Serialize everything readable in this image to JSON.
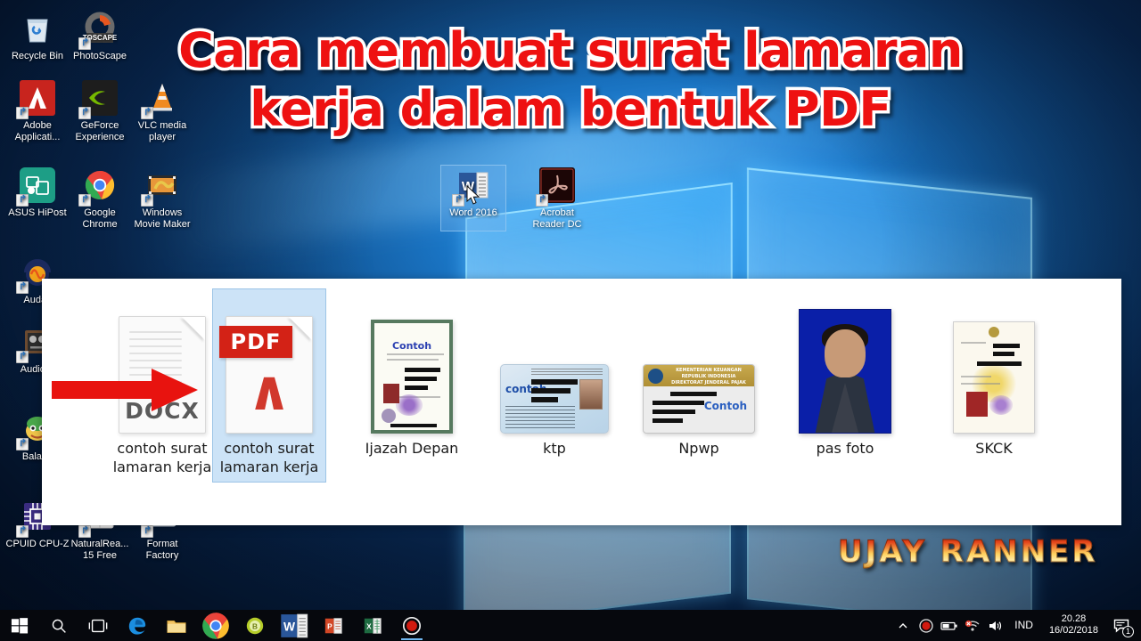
{
  "banner": {
    "line1": "Cara membuat surat lamaran",
    "line2": "kerja dalam bentuk PDF",
    "color": "#ee1111",
    "outline_color": "#ffffff"
  },
  "watermark": {
    "text": "UJAY RANNER"
  },
  "desktop": {
    "icons": [
      {
        "label": "Recycle Bin",
        "icon": "recycle-bin-icon",
        "shortcut": false,
        "col": 0,
        "row": 0
      },
      {
        "label": "PhotoScape",
        "icon": "photoscape-icon",
        "shortcut": true,
        "col": 1,
        "row": 0
      },
      {
        "label": "Adobe Applicati...",
        "icon": "adobe-icon",
        "shortcut": true,
        "col": 0,
        "row": 1
      },
      {
        "label": "GeForce Experience",
        "icon": "geforce-icon",
        "shortcut": true,
        "col": 1,
        "row": 1
      },
      {
        "label": "VLC media player",
        "icon": "vlc-cone-icon",
        "shortcut": true,
        "col": 2,
        "row": 1
      },
      {
        "label": "ASUS HiPost",
        "icon": "asus-hipost-icon",
        "shortcut": true,
        "col": 0,
        "row": 2
      },
      {
        "label": "Google Chrome",
        "icon": "chrome-icon",
        "shortcut": true,
        "col": 1,
        "row": 2
      },
      {
        "label": "Windows Movie Maker",
        "icon": "movie-maker-icon",
        "shortcut": true,
        "col": 2,
        "row": 2
      },
      {
        "label": "Audac",
        "icon": "audacity-icon",
        "shortcut": true,
        "col": 0,
        "row": 3
      },
      {
        "label": "AudioW",
        "icon": "audio-device-icon",
        "shortcut": true,
        "col": 0,
        "row": 4
      },
      {
        "label": "Balabo",
        "icon": "balabolka-icon",
        "shortcut": true,
        "col": 0,
        "row": 5
      },
      {
        "label": "CPUID CPU-Z",
        "icon": "cpuz-icon",
        "shortcut": true,
        "col": 0,
        "row": 6
      },
      {
        "label": "NaturalRea... 15 Free",
        "icon": "naturalreader-icon",
        "shortcut": true,
        "col": 1,
        "row": 6
      },
      {
        "label": "Format Factory",
        "icon": "format-factory-icon",
        "shortcut": true,
        "col": 2,
        "row": 6
      }
    ],
    "center_icons": [
      {
        "label": "Word 2016",
        "icon": "word-icon",
        "shortcut": true,
        "selected": true
      },
      {
        "label": "Acrobat Reader DC",
        "icon": "acrobat-icon",
        "shortcut": true,
        "selected": false
      }
    ]
  },
  "panel": {
    "files": [
      {
        "name": "contoh surat lamaran kerja",
        "type": "docx",
        "selected": false
      },
      {
        "name": "contoh surat lamaran kerja",
        "type": "pdf",
        "selected": true
      },
      {
        "name": "Ijazah Depan",
        "type": "ijazah",
        "selected": false
      },
      {
        "name": "ktp",
        "type": "ktp",
        "selected": false
      },
      {
        "name": "Npwp",
        "type": "npwp",
        "selected": false
      },
      {
        "name": "pas foto",
        "type": "pasfoto",
        "selected": false
      },
      {
        "name": "SKCK",
        "type": "skck",
        "selected": false
      }
    ],
    "docx_badge": "DOCX",
    "pdf_badge": "PDF",
    "thumb_contoh_label": "Contoh",
    "npwp_header": "KEMENTERIAN KEUANGAN REPUBLIK INDONESIA DIREKTORAT JENDERAL PAJAK"
  },
  "taskbar": {
    "items": [
      {
        "name": "start-button",
        "icon": "windows-logo-icon"
      },
      {
        "name": "search-button",
        "icon": "search-icon"
      },
      {
        "name": "task-view-button",
        "icon": "task-view-icon"
      },
      {
        "name": "edge-button",
        "icon": "edge-icon"
      },
      {
        "name": "file-explorer-button",
        "icon": "folder-icon"
      },
      {
        "name": "chrome-button",
        "icon": "chrome-icon"
      },
      {
        "name": "app-green-button",
        "icon": "green-circle-app-icon"
      },
      {
        "name": "word-button",
        "icon": "word-icon"
      },
      {
        "name": "powerpoint-button",
        "icon": "powerpoint-icon"
      },
      {
        "name": "excel-button",
        "icon": "excel-icon"
      },
      {
        "name": "recorder-button",
        "icon": "record-icon"
      }
    ],
    "tray": {
      "chevron": "show-hidden-icons",
      "icons": [
        "record-icon",
        "battery-icon",
        "network-muted-icon",
        "volume-icon"
      ],
      "language": "IND",
      "time": "20.28",
      "date": "16/02/2018",
      "notification_count": "1"
    }
  }
}
